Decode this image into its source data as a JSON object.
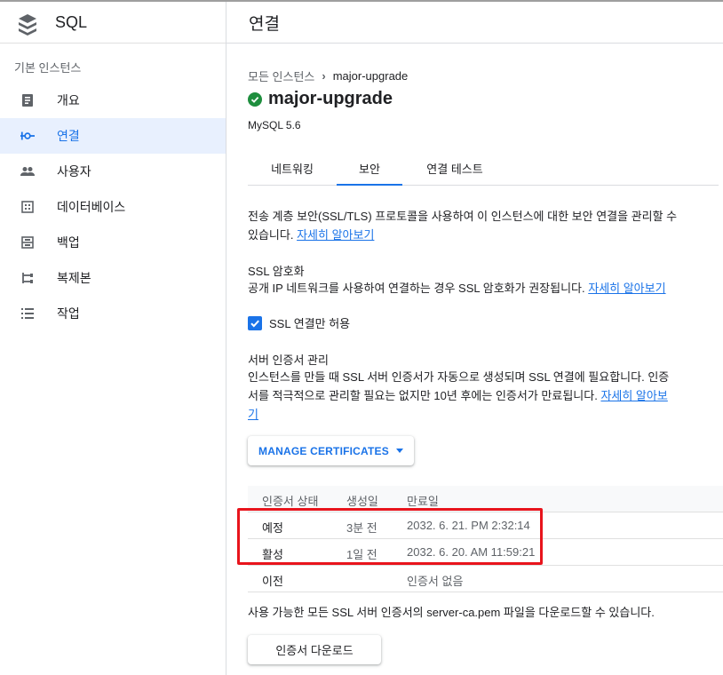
{
  "app": {
    "title": "SQL"
  },
  "sidebar": {
    "section_label": "기본 인스턴스",
    "items": [
      {
        "label": "개요",
        "icon": "overview-icon"
      },
      {
        "label": "연결",
        "icon": "connections-icon",
        "active": true
      },
      {
        "label": "사용자",
        "icon": "users-icon"
      },
      {
        "label": "데이터베이스",
        "icon": "databases-icon"
      },
      {
        "label": "백업",
        "icon": "backups-icon"
      },
      {
        "label": "복제본",
        "icon": "replicas-icon"
      },
      {
        "label": "작업",
        "icon": "operations-icon"
      }
    ]
  },
  "header": {
    "title": "연결"
  },
  "breadcrumb": {
    "parent": "모든 인스턴스",
    "current": "major-upgrade"
  },
  "instance": {
    "name": "major-upgrade",
    "version": "MySQL 5.6",
    "status_icon": "check-circle-icon"
  },
  "tabs": [
    {
      "label": "네트워킹"
    },
    {
      "label": "보안",
      "active": true
    },
    {
      "label": "연결 테스트"
    }
  ],
  "security": {
    "intro_line1": "전송 계층 보안(SSL/TLS) 프로토콜을 사용하여 이 인스턴스에 대한 보안 연결을 관리할 수",
    "intro_line2": "있습니다.",
    "intro_link": "자세히 알아보기",
    "ssl_heading": "SSL 암호화",
    "ssl_desc": "공개 IP 네트워크를 사용하여 연결하는 경우 SSL 암호화가 권장됩니다.",
    "ssl_link": "자세히 알아보기",
    "ssl_only_label": "SSL 연결만 허용",
    "ssl_only_checked": true,
    "server_cert_heading": "서버 인증서 관리",
    "server_cert_line1": "인스턴스를 만들 때 SSL 서버 인증서가 자동으로 생성되며 SSL 연결에 필요합니다. 인증",
    "server_cert_line2": "서를 적극적으로 관리할 필요는 없지만 10년 후에는 인증서가 만료됩니다.",
    "server_cert_link_a": "자세히 알아보",
    "server_cert_link_b": "기",
    "manage_button": "MANAGE CERTIFICATES",
    "table": {
      "headers": [
        "인증서 상태",
        "생성일",
        "만료일"
      ],
      "rows": [
        {
          "status": "예정",
          "created": "3분 전",
          "expires": "2032. 6. 21. PM 2:32:14"
        },
        {
          "status": "활성",
          "created": "1일 전",
          "expires": "2032. 6. 20. AM 11:59:21"
        },
        {
          "status": "이전",
          "created": "",
          "expires": "인증서 없음"
        }
      ]
    },
    "download_desc": "사용 가능한 모든 SSL 서버 인증서의 server-ca.pem 파일을 다운로드할 수 있습니다.",
    "download_button": "인증서 다운로드"
  },
  "colors": {
    "accent": "#1a73e8",
    "success": "#1e8e3e",
    "highlight": "#e8141c"
  }
}
